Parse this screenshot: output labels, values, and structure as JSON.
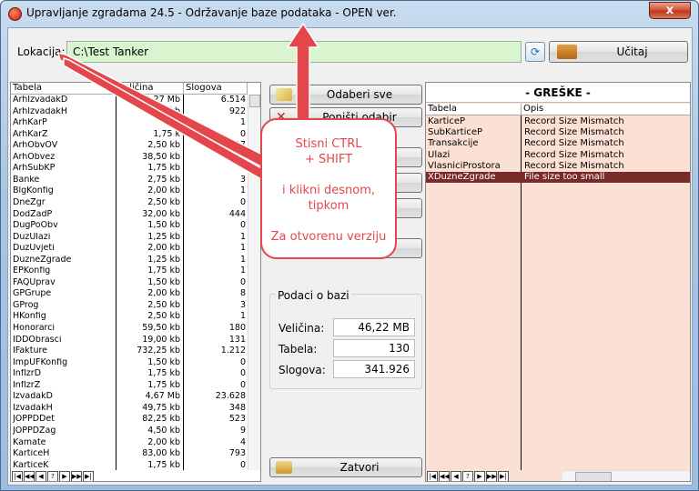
{
  "window": {
    "title": "Upravljanje zgradama 24.5 - Održavanje baze podataka - OPEN ver.",
    "close_glyph": "x"
  },
  "location": {
    "label": "Lokacija:",
    "value": "C:\\Test Tanker",
    "load_label": "Učitaj"
  },
  "tables_grid": {
    "columns": [
      "Tabela",
      "Veličina",
      "Slogova"
    ],
    "rows": [
      [
        "ArhIzvadakD",
        "1,27 Mb",
        "6.514"
      ],
      [
        "ArhIzvadakH",
        "75 kb",
        "922"
      ],
      [
        "ArhKarP",
        "",
        "1"
      ],
      [
        "ArhKarZ",
        "1,75 k",
        "0"
      ],
      [
        "ArhObvOV",
        "2,50 kb",
        "17"
      ],
      [
        "ArhObvez",
        "38,50 kb",
        ""
      ],
      [
        "ArhSubKP",
        "1,75 kb",
        ""
      ],
      [
        "Banke",
        "2,75 kb",
        "3"
      ],
      [
        "BlgKonfig",
        "2,00 kb",
        "1"
      ],
      [
        "DneZgr",
        "2,50 kb",
        "0"
      ],
      [
        "DodZadP",
        "32,00 kb",
        "444"
      ],
      [
        "DugPoObv",
        "1,50 kb",
        "0"
      ],
      [
        "DuzUlazi",
        "1,25 kb",
        "1"
      ],
      [
        "DuzUvjeti",
        "2,00 kb",
        "1"
      ],
      [
        "DuzneZgrade",
        "1,25 kb",
        "1"
      ],
      [
        "EPKonfig",
        "1,75 kb",
        "1"
      ],
      [
        "FAQUprav",
        "1,50 kb",
        "0"
      ],
      [
        "GPGrupe",
        "2,00 kb",
        "8"
      ],
      [
        "GProg",
        "2,50 kb",
        "3"
      ],
      [
        "HKonfig",
        "2,50 kb",
        "1"
      ],
      [
        "Honorarci",
        "59,50 kb",
        "180"
      ],
      [
        "IDDObrasci",
        "19,00 kb",
        "131"
      ],
      [
        "IFakture",
        "732,25 kb",
        "1.212"
      ],
      [
        "ImpUFKonfig",
        "1,50 kb",
        "0"
      ],
      [
        "InflzrD",
        "1,75 kb",
        "0"
      ],
      [
        "InflzrZ",
        "1,75 kb",
        "0"
      ],
      [
        "IzvadakD",
        "4,67 Mb",
        "23.628"
      ],
      [
        "IzvadakH",
        "49,75 kb",
        "348"
      ],
      [
        "JOPPDDet",
        "82,25 kb",
        "523"
      ],
      [
        "JOPPDZag",
        "4,50 kb",
        "9"
      ],
      [
        "Kamate",
        "2,00 kb",
        "4"
      ],
      [
        "KarticeH",
        "83,00 kb",
        "793"
      ],
      [
        "KarticeK",
        "1,75 kb",
        "0"
      ]
    ]
  },
  "nav_glyphs": [
    "|◀",
    "◀◀",
    "◀",
    "?",
    "▶",
    "▶▶",
    "▶|"
  ],
  "actions": {
    "select_all": "Odaberi sve",
    "deselect": "Poništi odabir",
    "close": "Zatvori"
  },
  "db_info": {
    "title": "Podaci o bazi",
    "size_label": "Veličina:",
    "size_value": "46,22 MB",
    "tables_label": "Tabela:",
    "tables_value": "130",
    "records_label": "Slogova:",
    "records_value": "341.926"
  },
  "errors": {
    "title": "- GREŠKE -",
    "columns": [
      "Tabela",
      "Opis"
    ],
    "rows": [
      [
        "KarticeP",
        "Record Size Mismatch"
      ],
      [
        "SubKarticeP",
        "Record Size Mismatch"
      ],
      [
        "Transakcije",
        "Record Size Mismatch"
      ],
      [
        "Ulazi",
        "Record Size Mismatch"
      ],
      [
        "VlasniciProstora",
        "Record Size Mismatch"
      ],
      [
        "XDuzneZgrade",
        "File size too small"
      ]
    ],
    "selected_index": 5
  },
  "annotation": {
    "lines": [
      "Stisni CTRL",
      "+ SHIFT",
      "",
      "i klikni desnom,",
      "tipkom",
      "",
      "Za otvorenu verziju"
    ],
    "color": "#e4474b"
  }
}
